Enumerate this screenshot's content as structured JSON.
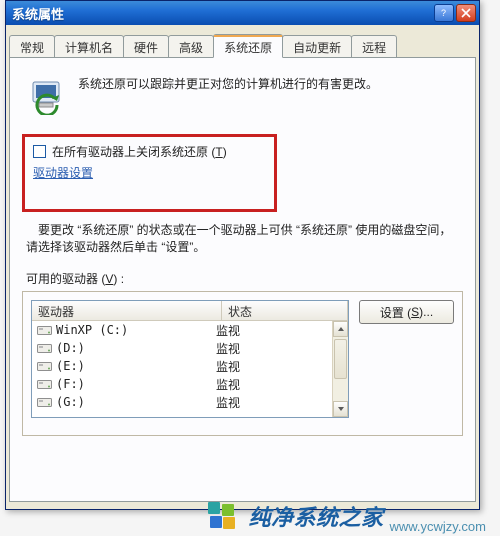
{
  "window": {
    "title": "系统属性"
  },
  "tabs": {
    "general": "常规",
    "computer_name": "计算机名",
    "hardware": "硬件",
    "advanced": "高级",
    "system_restore": "系统还原",
    "auto_update": "自动更新",
    "remote": "远程"
  },
  "intro_text": "系统还原可以跟踪并更正对您的计算机进行的有害更改。",
  "disable_checkbox": {
    "label_prefix": "在所有驱动器上关闭系统还原 (",
    "label_hotkey": "T",
    "label_suffix": ")"
  },
  "drive_settings_link": "驱动器设置",
  "description": "要更改 “系统还原” 的状态或在一个驱动器上可供 “系统还原” 使用的磁盘空间，请选择该驱动器然后单击 “设置”。",
  "available_drives": {
    "label_prefix": "可用的驱动器 (",
    "label_hotkey": "V",
    "label_suffix": ") :"
  },
  "columns": {
    "drive": "驱动器",
    "status": "状态"
  },
  "drives": [
    {
      "name": "WinXP (C:)",
      "status": "监视"
    },
    {
      "name": "(D:)",
      "status": "监视"
    },
    {
      "name": "(E:)",
      "status": "监视"
    },
    {
      "name": "(F:)",
      "status": "监视"
    },
    {
      "name": "(G:)",
      "status": "监视"
    }
  ],
  "settings_button": {
    "label_prefix": "设置 (",
    "label_hotkey": "S",
    "label_suffix": ")..."
  },
  "watermark": {
    "brand": "纯净系统之家",
    "url": "www.ycwjzy.com"
  }
}
